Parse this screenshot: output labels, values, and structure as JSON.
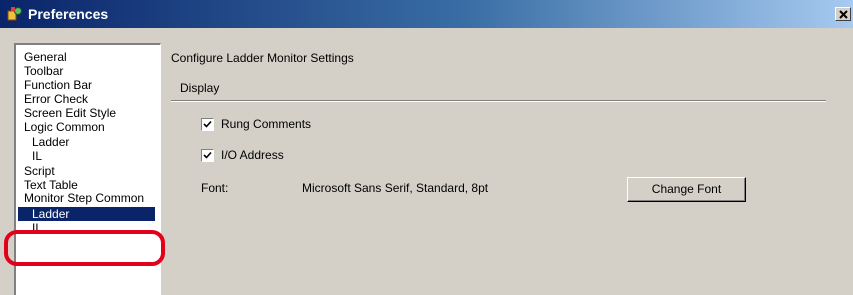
{
  "window": {
    "title": "Preferences"
  },
  "nav": {
    "items": [
      {
        "label": "General",
        "selected": false
      },
      {
        "label": "Toolbar",
        "selected": false
      },
      {
        "label": "Function Bar",
        "selected": false
      },
      {
        "label": "Error Check",
        "selected": false
      },
      {
        "label": "Screen Edit Style",
        "selected": false
      },
      {
        "label": "Logic Common",
        "selected": false
      },
      {
        "label": "Ladder",
        "selected": false
      },
      {
        "label": "IL",
        "selected": false
      },
      {
        "label": "Script",
        "selected": false
      },
      {
        "label": "Text Table",
        "selected": false
      },
      {
        "label": "Monitor Step Common",
        "selected": false
      },
      {
        "label": "Ladder",
        "selected": true
      },
      {
        "label": "IL",
        "selected": false
      }
    ]
  },
  "main": {
    "section_title": "Configure Ladder Monitor Settings",
    "group_label": "Display",
    "options": [
      {
        "label": "Rung Comments",
        "checked": true
      },
      {
        "label": "I/O Address",
        "checked": true
      }
    ],
    "font_label": "Font:",
    "font_value": "Microsoft Sans Serif, Standard, 8pt",
    "change_font_label": "Change Font"
  },
  "colors": {
    "selection": "#0a246a",
    "highlight_ring": "#e3001b",
    "dialog_face": "#d4d0c8"
  }
}
